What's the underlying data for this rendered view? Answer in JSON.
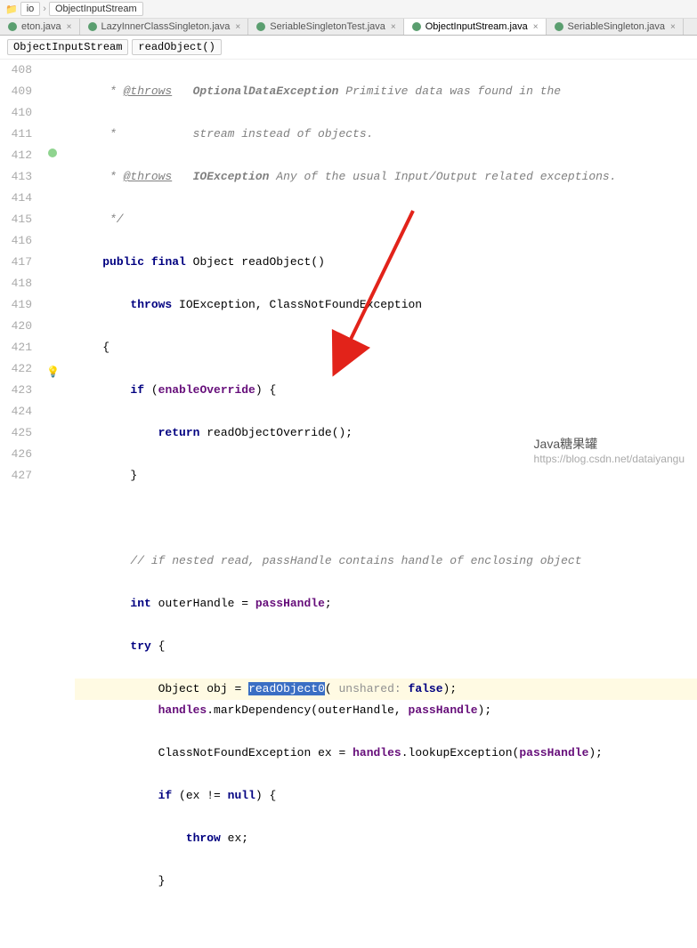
{
  "breadcrumb": {
    "item1": "io",
    "item2": "ObjectInputStream"
  },
  "tabs": [
    {
      "label": "eton.java",
      "active": false
    },
    {
      "label": "LazyInnerClassSingleton.java",
      "active": false
    },
    {
      "label": "SeriableSingletonTest.java",
      "active": false
    },
    {
      "label": "ObjectInputStream.java",
      "active": true
    },
    {
      "label": "SeriableSingleton.java",
      "active": false
    }
  ],
  "nav": {
    "class": "ObjectInputStream",
    "method": "readObject()"
  },
  "lines": {
    "l408": "408",
    "l409": "409",
    "l410": "410",
    "l411": "411",
    "l412": "412",
    "l413": "413",
    "l414": "414",
    "l415": "415",
    "l416": "416",
    "l417": "417",
    "l418": "418",
    "l419": "419",
    "l420": "420",
    "l421": "421",
    "l422": "422",
    "l423": "423",
    "l424": "424",
    "l425": "425",
    "l426": "426",
    "l427": "427"
  },
  "code": {
    "throws1": "@throws",
    "opt_ex": "OptionalDataException",
    "doc1": "Primitive data was found in the",
    "doc2": "stream instead of objects.",
    "throws2": "@throws",
    "ioex": "IOException",
    "doc3": "Any of the usual Input/Output related exceptions.",
    "public": "public",
    "final": "final",
    "object": "Object",
    "readObject": "readObject",
    "throws_kw": "throws",
    "ioexception": "IOException",
    "cnfe": "ClassNotFoundException",
    "if": "if",
    "enableOverride": "enableOverride",
    "return": "return",
    "readObjectOverride": "readObjectOverride",
    "comment_nested": "// if nested read, passHandle contains handle of enclosing object",
    "int": "int",
    "outerHandle": "outerHandle",
    "passHandle": "passHandle",
    "try": "try",
    "obj": "obj",
    "readObject0": "readObject0",
    "unshared": "unshared:",
    "false": "false",
    "handles": "handles",
    "markDependency": "markDependency",
    "cnfe2": "ClassNotFoundException",
    "ex": "ex",
    "lookupException": "lookupException",
    "null": "null",
    "throw": "throw"
  },
  "watermark": {
    "main": "Java糖果罐",
    "sub": "https://blog.csdn.net/dataiyangu"
  }
}
